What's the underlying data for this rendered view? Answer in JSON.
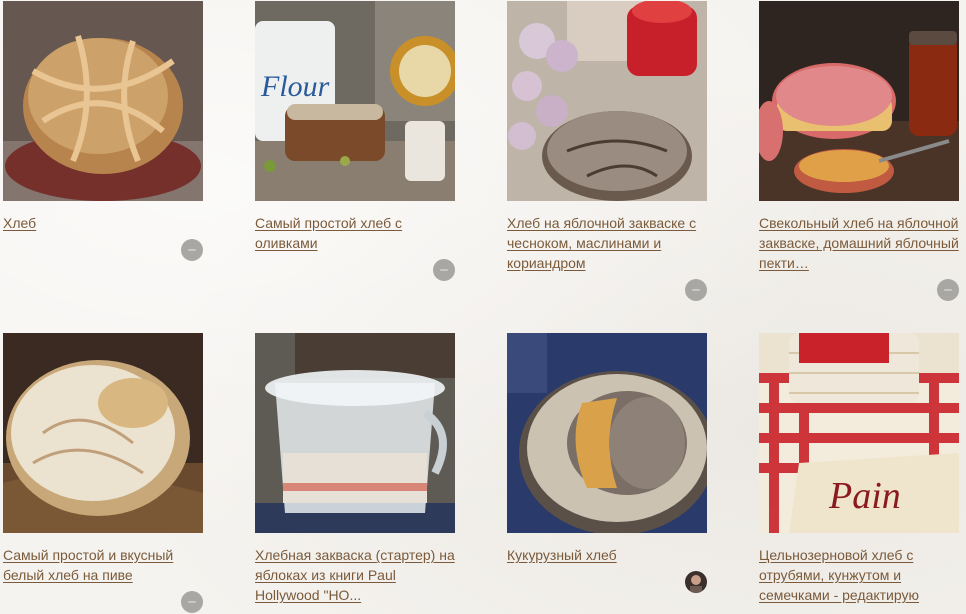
{
  "recipes": [
    {
      "title": "Хлеб",
      "thumb_icon": "round-bread-loaf-photo"
    },
    {
      "title": "Самый простой хлеб с оливками",
      "thumb_icon": "bread-with-flour-canister-photo"
    },
    {
      "title": "Хлеб на яблочной закваске с чесноком, маслинами и кориандром",
      "thumb_icon": "bread-with-garlic-photo"
    },
    {
      "title": "Свекольный хлеб на яблочной закваске, домашний яблочный пекти…",
      "thumb_icon": "beet-bread-photo"
    },
    {
      "title": "Самый простой и вкусный белый хлеб на пиве",
      "thumb_icon": "white-bread-photo"
    },
    {
      "title": "Хлебная закваска (стартер) на яблоках из книги Paul Hollywood \"НО...",
      "thumb_icon": "sourdough-starter-jar-photo"
    },
    {
      "title": "Кукурузный хлеб",
      "thumb_icon": "corn-bread-in-basket-photo"
    },
    {
      "title": "Цельнозерновой хлеб с отрубями, кунжутом и семечками - редактирую",
      "thumb_icon": "basket-with-pain-towel-photo"
    }
  ],
  "colors": {
    "link": "#7a5a3a",
    "avatar": "#a9a7a4",
    "background": "#f5f3ef"
  }
}
